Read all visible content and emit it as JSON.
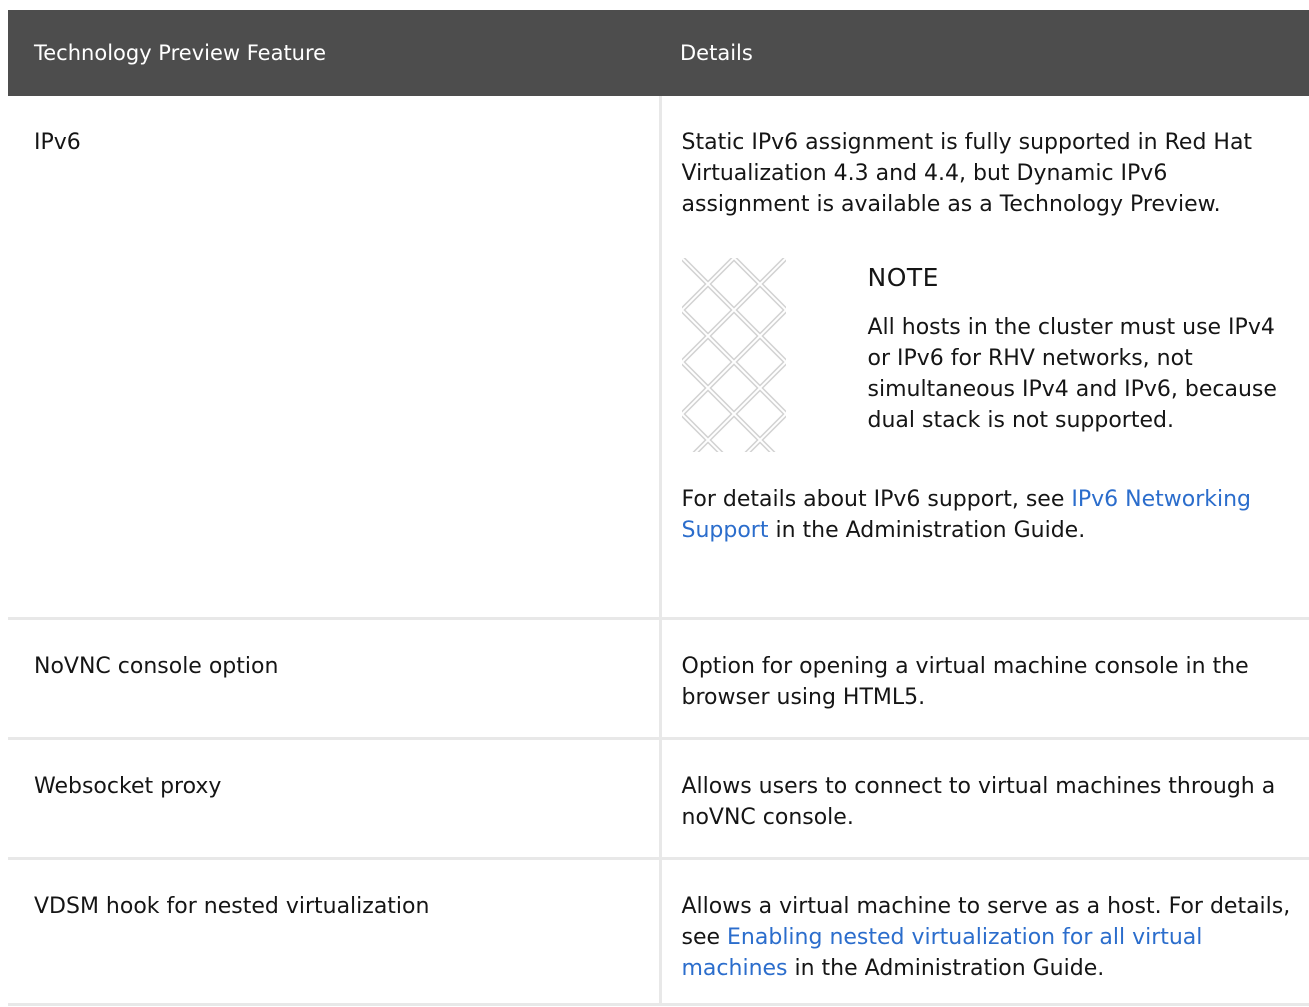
{
  "table": {
    "headers": {
      "feature": "Technology Preview Feature",
      "details": "Details"
    },
    "rows": [
      {
        "feature": "IPv6",
        "details_text": "Static IPv6 assignment is fully supported in Red Hat Virtualization 4.3 and 4.4, but Dynamic IPv6 assignment is available as a Technology Preview.",
        "note": {
          "title": "NOTE",
          "text": "All hosts in the cluster must use IPv4 or IPv6 for RHV networks, not simultaneous IPv4 and IPv6, because dual stack is not supported."
        },
        "footer": {
          "before": "For details about IPv6 support, see ",
          "link": "IPv6 Networking Support",
          "after": " in the Administration Guide."
        }
      },
      {
        "feature": "NoVNC console option",
        "details_text": "Option for opening a virtual machine console in the browser using HTML5."
      },
      {
        "feature": "Websocket proxy",
        "details_text": "Allows users to connect to virtual machines through a noVNC console."
      },
      {
        "feature": "VDSM hook for nested virtualization",
        "details_before": "Allows a virtual machine to serve as a host. For details, see ",
        "details_link": "Enabling nested virtualization for all virtual machines",
        "details_after": " in the Administration Guide."
      }
    ]
  },
  "colors": {
    "header_bg": "#4d4d4d",
    "header_text": "#ffffff",
    "border": "#e8e8e8",
    "link": "#2b6dcc",
    "note_icon": "#d2d2d2"
  },
  "icons": {
    "note_icon": "note-pattern-icon"
  }
}
